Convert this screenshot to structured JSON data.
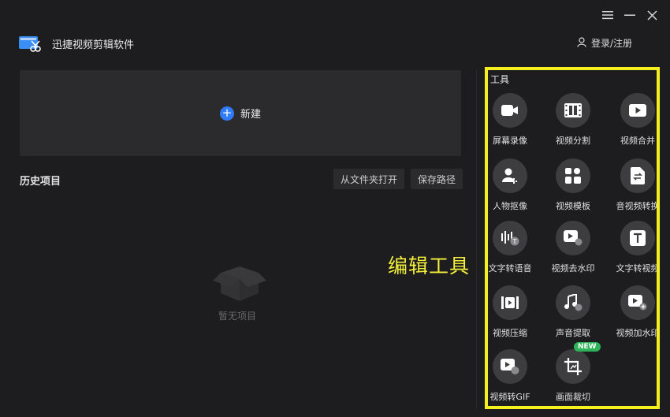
{
  "window": {
    "menu_icon": "menu-icon",
    "min_icon": "minimize-icon",
    "close_icon": "close-icon"
  },
  "header": {
    "app_title": "迅捷视频剪辑软件",
    "login_label": "登录/注册"
  },
  "new_project": {
    "label": "新建"
  },
  "history": {
    "title": "历史项目",
    "open_folder_label": "从文件夹打开",
    "save_path_label": "保存路径",
    "empty_text": "暂无项目"
  },
  "annotation": "编辑工具",
  "tools": {
    "title": "工具",
    "new_badge": "NEW",
    "items": [
      {
        "label": "屏幕录像",
        "icon": "camera-icon"
      },
      {
        "label": "视频分割",
        "icon": "film-split-icon"
      },
      {
        "label": "视频合并",
        "icon": "play-merge-icon"
      },
      {
        "label": "人物抠像",
        "icon": "person-cutout-icon"
      },
      {
        "label": "视频模板",
        "icon": "template-grid-icon"
      },
      {
        "label": "音视频转换",
        "icon": "file-convert-icon"
      },
      {
        "label": "文字转语音",
        "icon": "text-to-speech-icon"
      },
      {
        "label": "视频去水印",
        "icon": "watermark-remove-icon"
      },
      {
        "label": "文字转视频",
        "icon": "text-to-video-icon"
      },
      {
        "label": "视频压缩",
        "icon": "compress-icon"
      },
      {
        "label": "声音提取",
        "icon": "music-note-icon"
      },
      {
        "label": "视频加水印",
        "icon": "watermark-add-icon"
      },
      {
        "label": "视频转GIF",
        "icon": "gif-icon"
      },
      {
        "label": "画面裁切",
        "icon": "crop-icon"
      }
    ]
  }
}
